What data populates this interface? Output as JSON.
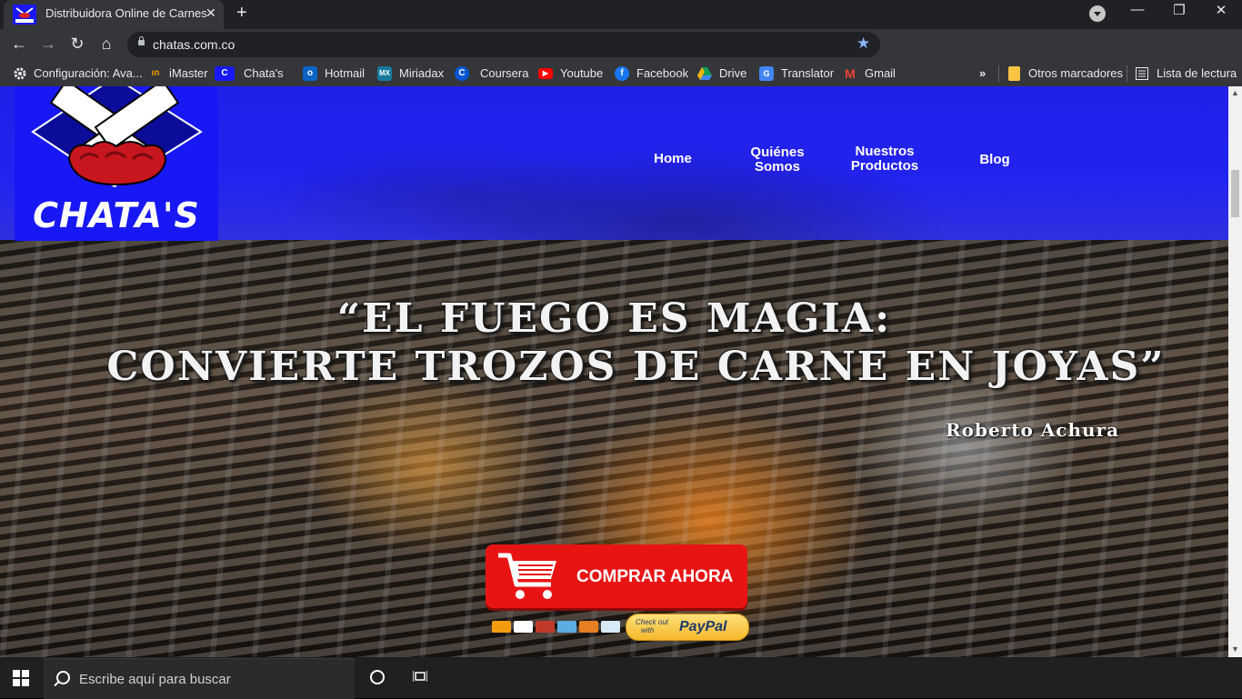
{
  "browser": {
    "tab_title": "Distribuidora Online de Carnes",
    "tab_close": "✕",
    "new_tab": "+",
    "url": "chatas.com.co",
    "window_controls": {
      "minimize": "—",
      "restore": "❐",
      "close": "✕"
    },
    "nav": {
      "back": "←",
      "forward": "→",
      "reload": "↻",
      "home": "⌂"
    },
    "star": "★"
  },
  "bookmarks": {
    "items": [
      {
        "label": "Configuración: Ava...",
        "icon": "gear-icon"
      },
      {
        "label": "iMaster",
        "icon": "imaster-icon"
      },
      {
        "label": "Chata's",
        "icon": "chatas-icon"
      },
      {
        "label": "Hotmail",
        "icon": "outlook-icon"
      },
      {
        "label": "Miriadax",
        "icon": "miriadax-icon"
      },
      {
        "label": "Coursera",
        "icon": "coursera-icon"
      },
      {
        "label": "Youtube",
        "icon": "youtube-icon"
      },
      {
        "label": "Facebook",
        "icon": "facebook-icon"
      },
      {
        "label": "Drive",
        "icon": "drive-icon"
      },
      {
        "label": "Translator",
        "icon": "translate-icon"
      },
      {
        "label": "Gmail",
        "icon": "gmail-icon"
      }
    ],
    "more": "»",
    "other": "Otros marcadores",
    "reading_list": "Lista de lectura"
  },
  "site": {
    "logo_text": "CHATA'S",
    "nav": {
      "home": "Home",
      "quienes_1": "Quiénes",
      "quienes_2": "Somos",
      "productos_1": "Nuestros",
      "productos_2": "Productos",
      "blog": "Blog"
    },
    "quote_line1": "“EL FUEGO ES MAGIA:",
    "quote_line2": "CONVIERTE TROZOS DE CARNE EN JOYAS”",
    "author": "Roberto Achura",
    "buy_button": "COMPRAR AHORA",
    "paypal_small_1": "Check out",
    "paypal_small_2": "with",
    "paypal_big": "PayPal",
    "colors": {
      "header_blue": "#2323f0",
      "buy_red": "#e81414",
      "paypal_yellow": "#f5b82a"
    }
  },
  "taskbar": {
    "search_placeholder": "Escribe aquí para buscar"
  }
}
